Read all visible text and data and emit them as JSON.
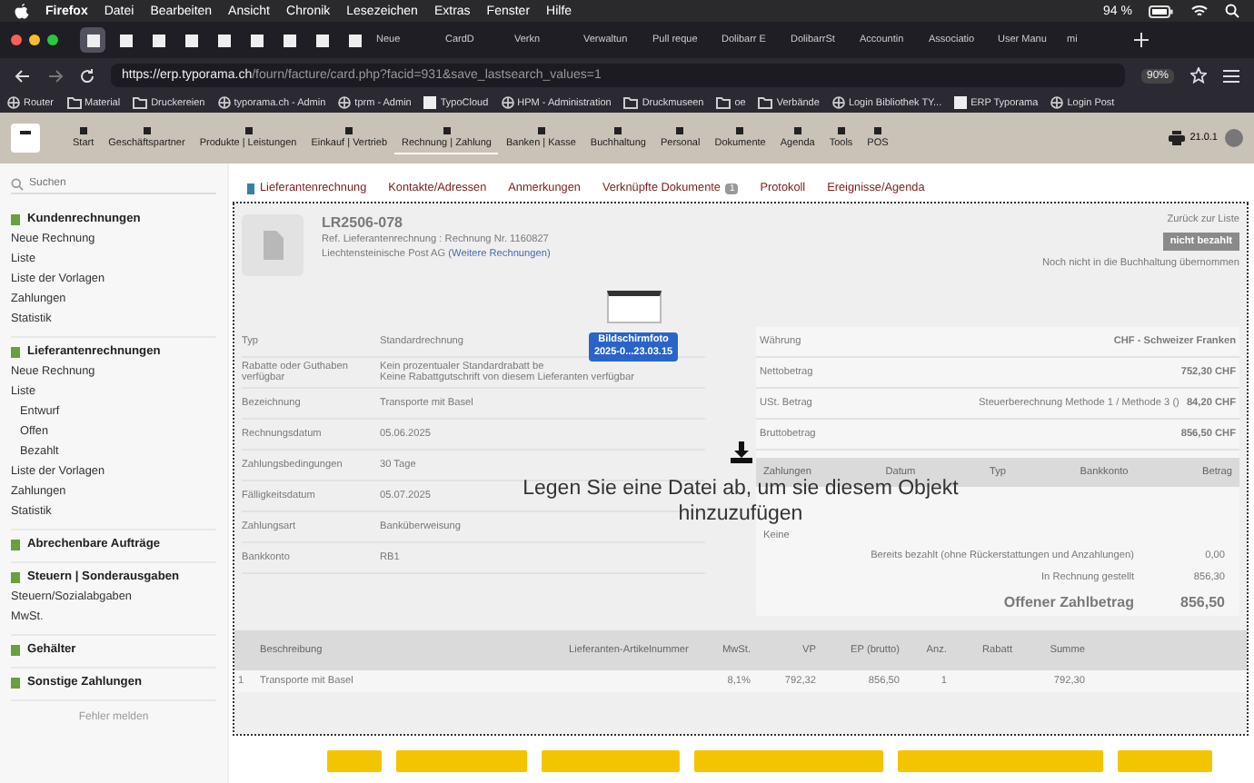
{
  "menubar": {
    "items": [
      "Firefox",
      "Datei",
      "Bearbeiten",
      "Ansicht",
      "Chronik",
      "Lesezeichen",
      "Extras",
      "Fenster",
      "Hilfe"
    ],
    "battery": "94 %"
  },
  "browser_tabs": [
    {
      "kind": "icon",
      "selected": true
    },
    {
      "kind": "icon",
      "selected": false
    },
    {
      "kind": "icon",
      "selected": false
    },
    {
      "kind": "icon",
      "selected": false
    },
    {
      "kind": "icon",
      "selected": false
    },
    {
      "kind": "icon",
      "selected": false
    },
    {
      "kind": "icon",
      "selected": false
    },
    {
      "kind": "icon",
      "selected": false
    },
    {
      "kind": "icon",
      "selected": false
    },
    {
      "kind": "text",
      "label": "Neue",
      "selected": false
    },
    {
      "kind": "text",
      "label": "CardD",
      "selected": false
    },
    {
      "kind": "text",
      "label": "Verkn",
      "selected": false
    },
    {
      "kind": "text",
      "label": "Verwaltun",
      "selected": false
    },
    {
      "kind": "text",
      "label": "Pull reque",
      "selected": false
    },
    {
      "kind": "text",
      "label": "Dolibarr E",
      "selected": false
    },
    {
      "kind": "text",
      "label": "DolibarrSt",
      "selected": false
    },
    {
      "kind": "text",
      "label": "Accountin",
      "selected": false
    },
    {
      "kind": "text",
      "label": "Associatio",
      "selected": false
    },
    {
      "kind": "text",
      "label": "User Manu",
      "selected": false
    },
    {
      "kind": "text",
      "label": "mi",
      "selected": false
    }
  ],
  "address_bar": {
    "url_host": "https://erp.typorama.ch",
    "url_path": "/fourn/facture/card.php?facid=931&save_lastsearch_values=1",
    "zoom": "90%"
  },
  "bookmarks": [
    {
      "kind": "globe",
      "label": "Router"
    },
    {
      "kind": "folder",
      "label": "Material"
    },
    {
      "kind": "folder",
      "label": "Druckereien"
    },
    {
      "kind": "globe",
      "label": "typorama.ch - Admin"
    },
    {
      "kind": "globe",
      "label": "tprm - Admin"
    },
    {
      "kind": "page",
      "label": "TypoCloud"
    },
    {
      "kind": "globe",
      "label": "HPM - Administration"
    },
    {
      "kind": "folder",
      "label": "Druckmuseen"
    },
    {
      "kind": "folder",
      "label": "oe"
    },
    {
      "kind": "folder",
      "label": "Verbände"
    },
    {
      "kind": "globe",
      "label": "Login Bibliothek TY..."
    },
    {
      "kind": "page",
      "label": "ERP Typorama"
    },
    {
      "kind": "globe",
      "label": "Login Post"
    }
  ],
  "app_nav": {
    "items": [
      {
        "label": "Start",
        "selected": false
      },
      {
        "label": "Geschäftspartner",
        "selected": false
      },
      {
        "label": "Produkte | Leistungen",
        "selected": false
      },
      {
        "label": "Einkauf | Vertrieb",
        "selected": false
      },
      {
        "label": "Rechnung | Zahlung",
        "selected": true
      },
      {
        "label": "Banken | Kasse",
        "selected": false
      },
      {
        "label": "Buchhaltung",
        "selected": false
      },
      {
        "label": "Personal",
        "selected": false
      },
      {
        "label": "Dokumente",
        "selected": false
      },
      {
        "label": "Agenda",
        "selected": false
      },
      {
        "label": "Tools",
        "selected": false
      },
      {
        "label": "POS",
        "selected": false
      }
    ],
    "version": "21.0.1"
  },
  "sidebar": {
    "search": {
      "placeholder": "Suchen"
    },
    "sections": [
      {
        "title": "Kundenrechnungen",
        "items": [
          {
            "label": "Neue Rechnung"
          },
          {
            "label": "Liste"
          },
          {
            "label": "Liste der Vorlagen"
          },
          {
            "label": "Zahlungen"
          },
          {
            "label": "Statistik"
          }
        ]
      },
      {
        "title": "Lieferantenrechnungen",
        "items": [
          {
            "label": "Neue Rechnung"
          },
          {
            "label": "Liste",
            "children": [
              {
                "label": "Entwurf"
              },
              {
                "label": "Offen"
              },
              {
                "label": "Bezahlt"
              }
            ]
          },
          {
            "label": "Liste der Vorlagen"
          },
          {
            "label": "Zahlungen"
          },
          {
            "label": "Statistik"
          }
        ]
      },
      {
        "title": "Abrechenbare Aufträge"
      },
      {
        "title": "Steuern | Sonderausgaben",
        "items": [
          {
            "label": "Steuern/Sozialabgaben"
          },
          {
            "label": "MwSt."
          }
        ]
      },
      {
        "title": "Gehälter"
      },
      {
        "title": "Sonstige Zahlungen"
      }
    ],
    "footer": "Fehler melden"
  },
  "tabs": [
    {
      "label": "Lieferantenrechnung"
    },
    {
      "label": "Kontakte/Adressen"
    },
    {
      "label": "Anmerkungen"
    },
    {
      "label": "Verknüpfte Dokumente",
      "badge": "1"
    },
    {
      "label": "Protokoll"
    },
    {
      "label": "Ereignisse/Agenda"
    }
  ],
  "invoice": {
    "ref": "LR2506-078",
    "ref_supplier_label": "Ref. Lieferantenrechnung",
    "ref_supplier_value": ": Rechnung Nr. 1160827",
    "company": "Liechtensteinische Post AG",
    "company_link": "(Weitere Rechnungen)",
    "back_link": "Zurück zur Liste",
    "status": "nicht bezahlt",
    "accounting_note": "Noch nicht in die Buchhaltung übernommen",
    "fields": [
      {
        "label": "Typ",
        "value_lines": [
          "Standardrechnung"
        ]
      },
      {
        "label": "Rabatte oder Guthaben verfügbar",
        "value_lines": [
          "Kein prozentualer Standardrabatt be",
          "Keine Rabattgutschrift von diesem Lieferanten verfügbar"
        ]
      },
      {
        "label": "Bezeichnung",
        "value_lines": [
          "Transporte mit Basel"
        ]
      },
      {
        "label": "Rechnungsdatum",
        "value_lines": [
          "05.06.2025"
        ]
      },
      {
        "label": "Zahlungsbedingungen",
        "value_lines": [
          "30 Tage"
        ]
      },
      {
        "label": "Fälligkeitsdatum",
        "value_lines": [
          "05.07.2025"
        ]
      },
      {
        "label": "Zahlungsart",
        "value_lines": [
          "Banküberweisung"
        ]
      },
      {
        "label": "Bankkonto",
        "value_lines": [
          "RB1"
        ]
      }
    ],
    "amounts": [
      {
        "label": "Währung",
        "value": "CHF - Schweizer Franken"
      },
      {
        "label": "Nettobetrag",
        "value": "752,30 CHF"
      },
      {
        "label": "USt. Betrag",
        "note": "Steuerberechnung Methode 1 / Methode 3 ()",
        "value": "84,20 CHF"
      },
      {
        "label": "Bruttobetrag",
        "value": "856,50 CHF"
      }
    ],
    "payments": {
      "columns": [
        "Zahlungen",
        "Datum",
        "Typ",
        "Bankkonto",
        "Betrag"
      ],
      "empty": "Keine",
      "totals": [
        {
          "label": "Bereits bezahlt (ohne Rückerstattungen und Anzahlungen)",
          "value": "0,00"
        },
        {
          "label": "In Rechnung gestellt",
          "value": "856,30"
        },
        {
          "label": "Offener Zahlbetrag",
          "value": "856,50"
        }
      ]
    },
    "lines": {
      "columns": [
        "Beschreibung",
        "Lieferanten-Artikelnummer",
        "MwSt.",
        "VP",
        "EP (brutto)",
        "Anz.",
        "Rabatt",
        "Summe"
      ],
      "rows": [
        {
          "num": "1",
          "cells": [
            "Transporte mit Basel",
            "",
            "8,1%",
            "792,32",
            "856,50",
            "1",
            "",
            "792,30"
          ]
        }
      ]
    }
  },
  "dragged_file": {
    "name_line1": "Bildschirmfoto",
    "name_line2": "2025-0...23.03.15"
  },
  "drop_message": "Legen Sie eine Datei ab, um sie diesem Objekt hinzuzufügen"
}
